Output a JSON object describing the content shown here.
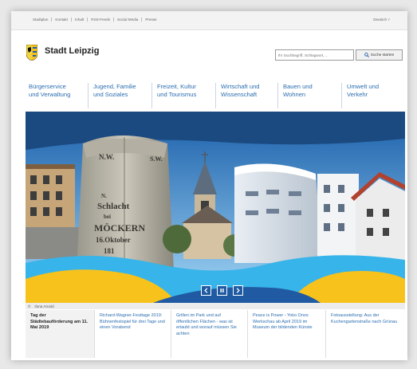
{
  "topbar": {
    "links": [
      "Stadtplan",
      "Kontakt",
      "Inhalt",
      "RSS-Feeds",
      "Social Media",
      "Presse"
    ],
    "language": "Deutsch ˅"
  },
  "header": {
    "title": "Stadt Leipzig",
    "search_placeholder": "Ihr Suchbegriff, Schlagwort, ...",
    "search_button": "Suche starten"
  },
  "nav": {
    "items": [
      {
        "line1": "Bürgerservice",
        "line2": "und Verwaltung"
      },
      {
        "line1": "Jugend, Familie",
        "line2": "und Soziales"
      },
      {
        "line1": "Freizeit, Kultur",
        "line2": "und Tourismus"
      },
      {
        "line1": "Wirtschaft und",
        "line2": "Wissenschaft"
      },
      {
        "line1": "Bauen und",
        "line2": "Wohnen"
      },
      {
        "line1": "Umwelt und",
        "line2": "Verkehr"
      }
    ]
  },
  "hero": {
    "stone": {
      "top_left": "N.W.",
      "top_right": "S.W.",
      "lines": [
        "N.",
        "Schlacht",
        "bei",
        "MÖCKERN",
        "16.Oktober",
        "181"
      ]
    },
    "caption_symbol": "©",
    "caption": "Ilona Arnold"
  },
  "news": {
    "items": [
      {
        "text": "Tag der Städtebauförderung am 11. Mai 2019"
      },
      {
        "text": "Richard-Wagner-Festtage 2019: Bühnenfestspiel für drei Tage und einen Vorabend"
      },
      {
        "text": "Grillen im Park und auf öffentlichen Flächen - was ist erlaubt und worauf müssen Sie achten"
      },
      {
        "text": "Peace is Power - Yoko Onos Werkschau ab April 2019 im Museum der bildenden Künste"
      },
      {
        "text": "Fotoausstellung: Aus der Kuchengartenstraße nach Grünau"
      }
    ]
  },
  "colors": {
    "link_blue": "#2a6db0",
    "hero_blue": "#1b4a81",
    "accent_yellow": "#f7c21b",
    "accent_cyan": "#37b4e9"
  }
}
